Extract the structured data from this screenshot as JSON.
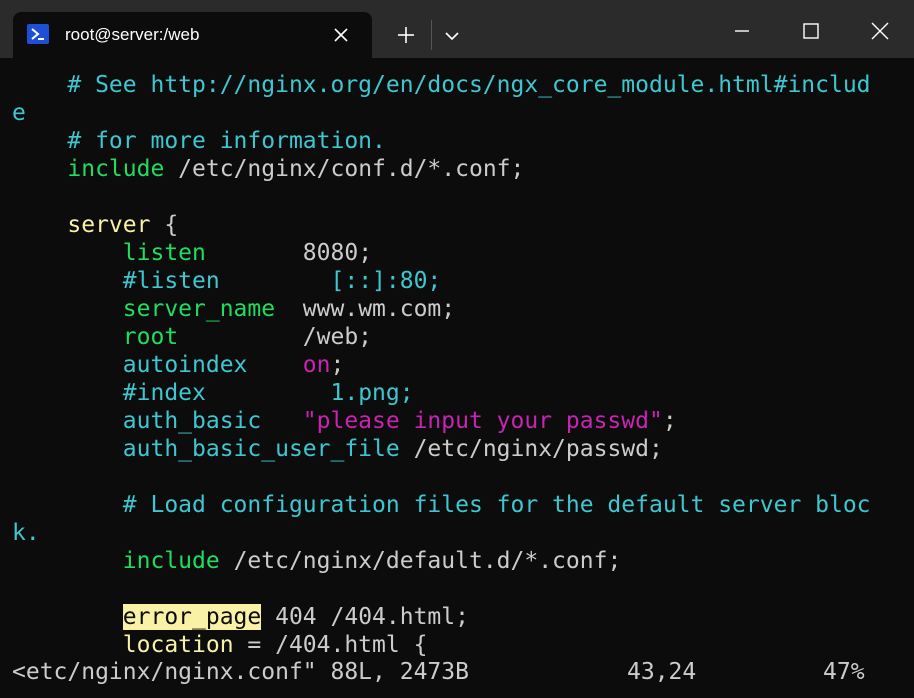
{
  "window": {
    "tab_title": "root@server:/web",
    "icons": {
      "tab": "powershell-icon",
      "tab_close": "close-icon",
      "new_tab": "plus-icon",
      "dropdown": "chevron-down-icon",
      "minimize": "minimize-icon",
      "maximize": "maximize-icon",
      "close": "close-icon"
    }
  },
  "colors": {
    "background": "#0c0c0c",
    "titlebar": "#2b2b2b",
    "comment": "#3ec7d0",
    "statement": "#f9f1a5",
    "keyword": "#20dd60",
    "string": "#c724b1",
    "default": "#cccccc",
    "search_highlight": "#f9f1a5"
  },
  "editor": {
    "lines": [
      {
        "segments": [
          {
            "text": "    # See http://nginx.org/en/docs/ngx_core_module.html#includ",
            "cls": "c-comment"
          }
        ]
      },
      {
        "segments": [
          {
            "text": "e",
            "cls": "c-comment"
          }
        ]
      },
      {
        "segments": [
          {
            "text": "    # for more information.",
            "cls": "c-comment"
          }
        ]
      },
      {
        "segments": [
          {
            "text": "    include",
            "cls": "c-kw"
          },
          {
            "text": " /etc/nginx/conf.d/*.conf;",
            "cls": "c-default"
          }
        ]
      },
      {
        "segments": [
          {
            "text": "",
            "cls": "c-default"
          }
        ]
      },
      {
        "segments": [
          {
            "text": "    server",
            "cls": "c-stmt"
          },
          {
            "text": " {",
            "cls": "c-default"
          }
        ]
      },
      {
        "segments": [
          {
            "text": "        listen",
            "cls": "c-kw"
          },
          {
            "text": "       8080;",
            "cls": "c-default"
          }
        ]
      },
      {
        "segments": [
          {
            "text": "        #listen",
            "cls": "c-comment"
          },
          {
            "text": "        [::]:80;",
            "cls": "c-comment"
          }
        ]
      },
      {
        "segments": [
          {
            "text": "        server_name",
            "cls": "c-kw"
          },
          {
            "text": "  www.wm.com;",
            "cls": "c-default"
          }
        ]
      },
      {
        "segments": [
          {
            "text": "        root",
            "cls": "c-kw"
          },
          {
            "text": "         /web;",
            "cls": "c-default"
          }
        ]
      },
      {
        "segments": [
          {
            "text": "        autoindex",
            "cls": "c-directive"
          },
          {
            "text": "    ",
            "cls": "c-default"
          },
          {
            "text": "on",
            "cls": "c-special"
          },
          {
            "text": ";",
            "cls": "c-default"
          }
        ]
      },
      {
        "segments": [
          {
            "text": "        #index",
            "cls": "c-comment"
          },
          {
            "text": "         1.png;",
            "cls": "c-comment"
          }
        ]
      },
      {
        "segments": [
          {
            "text": "        auth_basic",
            "cls": "c-directive"
          },
          {
            "text": "   ",
            "cls": "c-default"
          },
          {
            "text": "\"please input your passwd\"",
            "cls": "c-string"
          },
          {
            "text": ";",
            "cls": "c-default"
          }
        ]
      },
      {
        "segments": [
          {
            "text": "        auth_basic_user_file",
            "cls": "c-directive"
          },
          {
            "text": " /etc/nginx/passwd;",
            "cls": "c-default"
          }
        ]
      },
      {
        "segments": [
          {
            "text": "",
            "cls": "c-default"
          }
        ]
      },
      {
        "segments": [
          {
            "text": "        # Load configuration files for the default server bloc",
            "cls": "c-comment"
          }
        ]
      },
      {
        "segments": [
          {
            "text": "k.",
            "cls": "c-comment"
          }
        ]
      },
      {
        "segments": [
          {
            "text": "        include",
            "cls": "c-kw"
          },
          {
            "text": " /etc/nginx/default.d/*.conf;",
            "cls": "c-default"
          }
        ]
      },
      {
        "segments": [
          {
            "text": "",
            "cls": "c-default"
          }
        ]
      },
      {
        "segments": [
          {
            "text": "        ",
            "cls": "c-default"
          },
          {
            "text": "error_page",
            "cls": "c-hl"
          },
          {
            "text": " 404 /404.html;",
            "cls": "c-default"
          }
        ]
      },
      {
        "segments": [
          {
            "text": "        location",
            "cls": "c-stmt"
          },
          {
            "text": " = /404.html {",
            "cls": "c-default"
          }
        ]
      }
    ],
    "status": {
      "file_info": "<etc/nginx/nginx.conf\" 88L, 2473B",
      "cursor_position": "43,24",
      "scroll_percent": "47%"
    }
  }
}
